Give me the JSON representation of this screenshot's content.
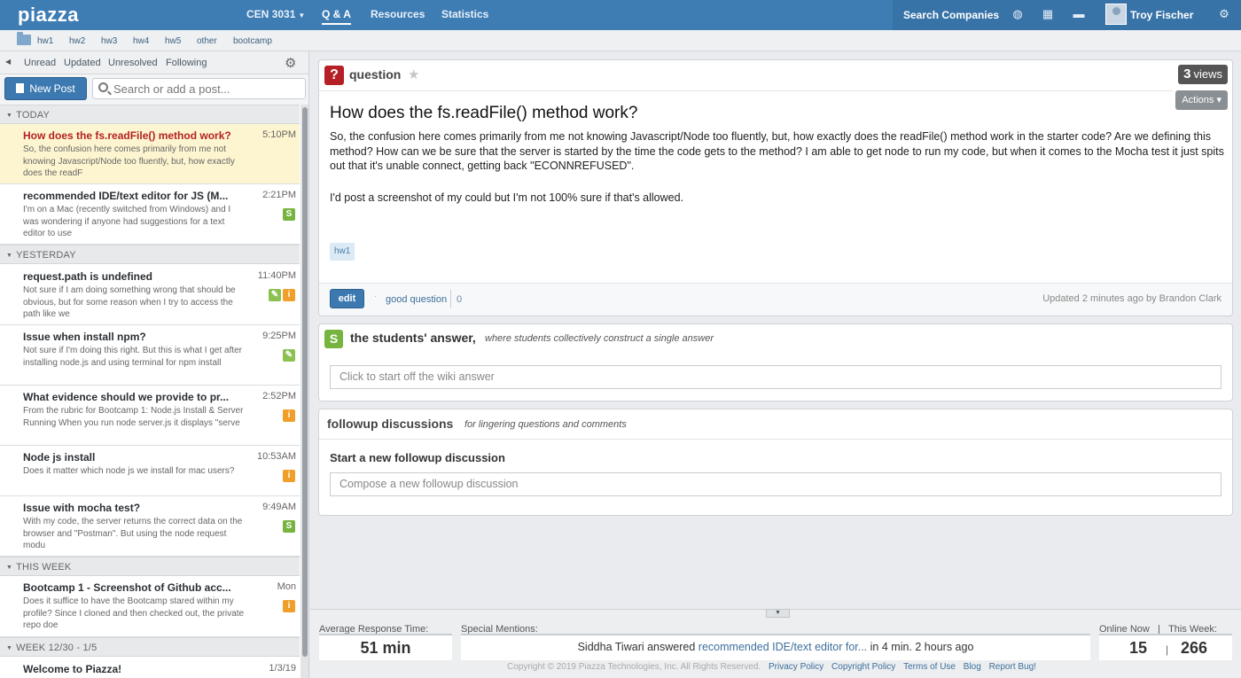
{
  "topbar": {
    "logo": "piazza",
    "class_name": "CEN 3031",
    "nav": [
      "Q & A",
      "Resources",
      "Statistics"
    ],
    "search_companies": "Search Companies",
    "user_name": "Troy Fischer"
  },
  "folders": [
    "hw1",
    "hw2",
    "hw3",
    "hw4",
    "hw5",
    "other",
    "bootcamp"
  ],
  "filters": [
    "Unread",
    "Updated",
    "Unresolved",
    "Following"
  ],
  "new_post_label": "New Post",
  "search_placeholder": "Search or add a post...",
  "feed": {
    "groups": [
      "TODAY",
      "YESTERDAY",
      "THIS WEEK",
      "WEEK 12/30 - 1/5"
    ],
    "posts": [
      {
        "title": "How does the fs.readFile() method work?",
        "time": "5:10PM",
        "snippet": "So, the confusion here comes primarily from me not knowing Javascript/Node too fluently, but, how exactly does the readF",
        "badges": []
      },
      {
        "title": "recommended IDE/text editor for JS (M...",
        "time": "2:21PM",
        "snippet": "I'm on a Mac (recently switched from Windows) and I was wondering if anyone had suggestions for a text editor to use",
        "badges": [
          "S"
        ]
      },
      {
        "title": "request.path is undefined",
        "time": "11:40PM",
        "snippet": "Not sure if I am doing something wrong that should be obvious, but for some reason when I try to access the path like we",
        "badges": [
          "✎",
          "i"
        ]
      },
      {
        "title": "Issue when install npm?",
        "time": "9:25PM",
        "snippet": "Not sure if I'm doing this right. But this is what I get after installing node.js and using terminal for npm install",
        "badges": [
          "✎"
        ]
      },
      {
        "title": "What evidence should we provide to pr...",
        "time": "2:52PM",
        "snippet": "From the rubric for Bootcamp 1: Node.js Install & Server Running When you run node server.js it displays \"serve",
        "badges": [
          "i"
        ]
      },
      {
        "title": "Node js install",
        "time": "10:53AM",
        "snippet": "Does it matter which node js we install for mac users?",
        "badges": [
          "i"
        ]
      },
      {
        "title": "Issue with mocha test?",
        "time": "9:49AM",
        "snippet": "With my code, the server returns the correct data on the browser and \"Postman\". But using the node request modu",
        "badges": [
          "S"
        ]
      },
      {
        "title": "Bootcamp 1 - Screenshot of Github acc...",
        "time": "Mon",
        "snippet": "Does it suffice to have the Bootcamp stared within my profile? Since I cloned and then checked out, the private repo doe",
        "badges": [
          "i"
        ]
      },
      {
        "title": "Welcome to Piazza!",
        "time": "1/3/19",
        "snippet": "",
        "badges": []
      }
    ]
  },
  "question": {
    "type_label": "question",
    "views_count": "3",
    "views_label": "views",
    "actions_label": "Actions",
    "title": "How does the fs.readFile() method work?",
    "body_1": "So, the confusion here comes primarily from me not knowing Javascript/Node too fluently, but, how exactly does the readFile() method work in the starter code? Are we defining this method? How can we be sure that the server is started by the time the code gets to the method? I am able to get node to run my code, but when it comes to the Mocha test it just spits out that it's unable connect, getting back \"ECONNREFUSED\".",
    "body_2": "I'd post a screenshot of my could but I'm not 100% sure if that's allowed.",
    "tag": "hw1",
    "edit_label": "edit",
    "good_question_label": "good question",
    "good_question_count": "0",
    "updated_text": "Updated 2 minutes ago by Brandon Clark"
  },
  "students_answer": {
    "icon": "S",
    "title": "the students' answer,",
    "subtitle": "where students collectively construct a single answer",
    "placeholder": "Click to start off the wiki answer"
  },
  "followup": {
    "title": "followup discussions",
    "subtitle": "for lingering questions and comments",
    "start_label": "Start a new followup discussion",
    "placeholder": "Compose a new followup discussion"
  },
  "stats": {
    "avg_label": "Average Response Time:",
    "avg_value": "51 min",
    "mentions_label": "Special Mentions:",
    "mention_user": "Siddha Tiwari answered",
    "mention_link": "recommended IDE/text editor for...",
    "mention_rest": "in 4 min. 2 hours ago",
    "online_label": "Online Now",
    "week_label": "This Week:",
    "online_sep": "|",
    "online_now": "15",
    "online_bar": "|",
    "this_week": "266"
  },
  "footer": {
    "copyright": "Copyright © 2019 Piazza Technologies, Inc. All Rights Reserved.",
    "links": [
      "Privacy Policy",
      "Copyright Policy",
      "Terms of Use",
      "Blog",
      "Report Bug!"
    ]
  },
  "colors": {
    "brand_blue": "#3e7cb4",
    "active_post_bg": "#fdf5d0",
    "active_post_title": "#b42223",
    "badge_s": "#77b43f",
    "badge_i": "#f0a02a"
  }
}
